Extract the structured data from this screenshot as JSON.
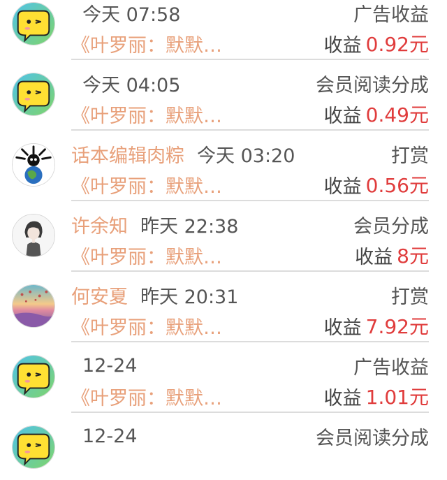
{
  "items": [
    {
      "avatar": "yellow-face",
      "name": "",
      "time": "今天 07:58",
      "type": "广告收益",
      "book": "《叶罗丽：默默…",
      "earn_label": "收益",
      "amount": "0.92元"
    },
    {
      "avatar": "yellow-face",
      "name": "",
      "time": "今天 04:05",
      "type": "会员阅读分成",
      "book": "《叶罗丽：默默…",
      "earn_label": "收益",
      "amount": "0.49元"
    },
    {
      "avatar": "earth-skull",
      "name": "话本编辑肉粽",
      "time": "今天 03:20",
      "type": "打赏",
      "book": "《叶罗丽：默默…",
      "earn_label": "收益",
      "amount": "0.56元"
    },
    {
      "avatar": "sketch-person",
      "name": "许余知",
      "time": "昨天 22:38",
      "type": "会员分成",
      "book": "《叶罗丽：默默…",
      "earn_label": "收益",
      "amount": "8元"
    },
    {
      "avatar": "sunset-balloons",
      "name": "何安夏",
      "time": "昨天 20:31",
      "type": "打赏",
      "book": "《叶罗丽：默默…",
      "earn_label": "收益",
      "amount": "7.92元"
    },
    {
      "avatar": "yellow-face",
      "name": "",
      "time": "12-24",
      "type": "广告收益",
      "book": "《叶罗丽：默默…",
      "earn_label": "收益",
      "amount": "1.01元"
    },
    {
      "avatar": "yellow-face",
      "name": "",
      "time": "12-24",
      "type": "会员阅读分成",
      "book": "",
      "earn_label": "",
      "amount": ""
    }
  ],
  "colors": {
    "name": "#e8a07a",
    "book": "#e8a07a",
    "amount": "#e03c3c",
    "text": "#555555"
  }
}
